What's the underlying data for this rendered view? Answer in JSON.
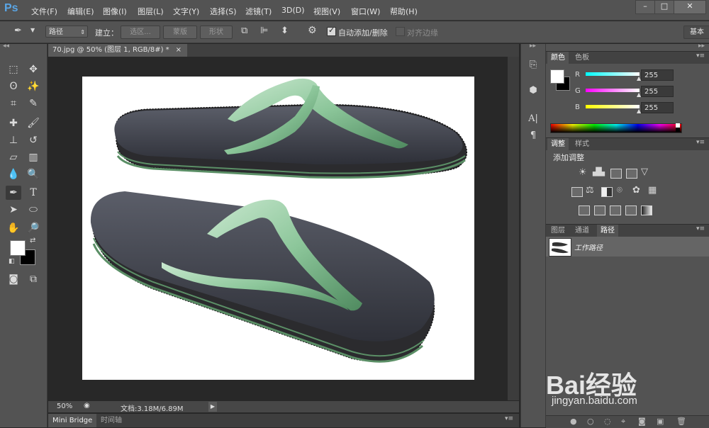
{
  "app": {
    "logo": "Ps"
  },
  "menu": [
    "文件(F)",
    "编辑(E)",
    "图像(I)",
    "图层(L)",
    "文字(Y)",
    "选择(S)",
    "滤镜(T)",
    "3D(D)",
    "视图(V)",
    "窗口(W)",
    "帮助(H)"
  ],
  "options_bar": {
    "tool_mode": "路径",
    "build_label": "建立：",
    "btn_selection": "选区...",
    "btn_mask": "蒙版",
    "btn_shape": "形状",
    "auto_add_delete": "自动添加/删除",
    "align_edges": "对齐边缘",
    "workspace": "基本"
  },
  "document": {
    "tab_title": "70.jpg @ 50% (图层 1, RGB/8#) *",
    "zoom": "50%",
    "doc_size": "文档:3.18M/6.89M"
  },
  "bottom_tabs": [
    "Mini Bridge",
    "时间轴"
  ],
  "color_panel": {
    "tabs": [
      "颜色",
      "色板"
    ],
    "channels": [
      {
        "label": "R",
        "value": "255",
        "gradient_from": "#00ffff",
        "gradient_to": "#ffffff"
      },
      {
        "label": "G",
        "value": "255",
        "gradient_from": "#ff00ff",
        "gradient_to": "#ffffff"
      },
      {
        "label": "B",
        "value": "255",
        "gradient_from": "#ffff00",
        "gradient_to": "#ffffff"
      }
    ]
  },
  "adjust_panel": {
    "tabs": [
      "调整",
      "样式"
    ],
    "title": "添加调整"
  },
  "layers_panel": {
    "tabs": [
      "图层",
      "通道",
      "路径"
    ],
    "path_name": "工作路径"
  },
  "watermark": {
    "brand": "Bai经验",
    "url": "jingyan.baidu.com"
  },
  "colors": {
    "accent": "#5aa6e6",
    "foreground": "#ffffff",
    "background": "#000000"
  }
}
